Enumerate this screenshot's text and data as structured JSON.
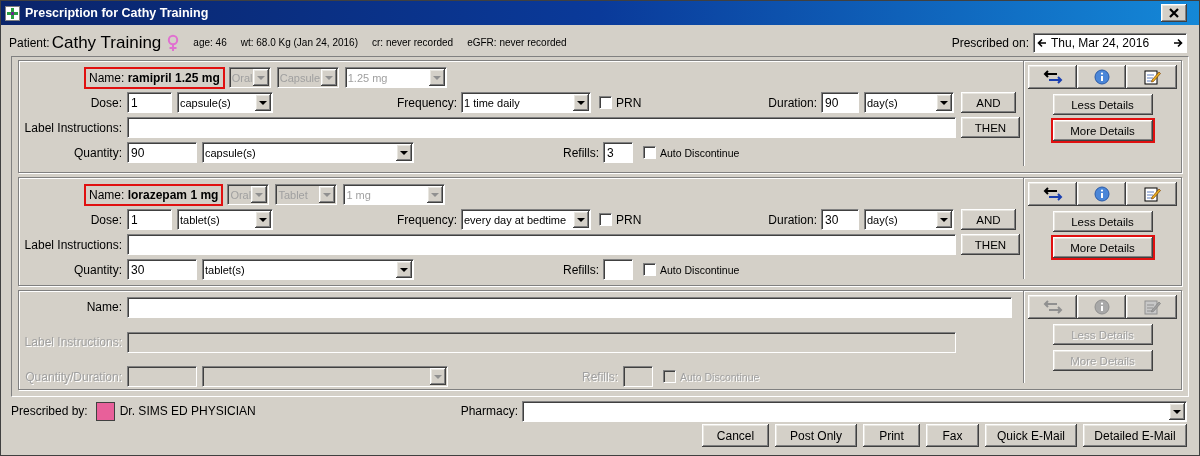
{
  "window": {
    "title": "Prescription for Cathy Training"
  },
  "patient": {
    "label": "Patient:",
    "name": "Cathy Training",
    "age": "age: 46",
    "weight": "wt: 68.0 Kg (Jan 24, 2016)",
    "cr": "cr: never recorded",
    "egfr": "eGFR: never recorded"
  },
  "prescribed_on": {
    "label": "Prescribed on:",
    "date": "Thu, Mar 24, 2016"
  },
  "prescriptions": [
    {
      "kind": "active",
      "name_label": "Name:",
      "name": "ramipril 1.25 mg",
      "highlighted": true,
      "route": "Oral",
      "form": "Capsule",
      "strength": "1.25 mg",
      "dose_label": "Dose:",
      "dose": "1",
      "dose_unit": "capsule(s)",
      "frequency_label": "Frequency:",
      "frequency": "1 time daily",
      "prn": {
        "label": "PRN",
        "checked": false
      },
      "duration_label": "Duration:",
      "duration": "90",
      "duration_unit": "day(s)",
      "and_button": "AND",
      "instructions_label": "Label Instructions:",
      "then_button": "THEN",
      "quantity_label": "Quantity:",
      "quantity": "90",
      "quantity_unit": "capsule(s)",
      "refills_label": "Refills:",
      "refills": "3",
      "auto_discontinue": {
        "label": "Auto Discontinue",
        "checked": false
      },
      "less_details": "Less Details",
      "more_details": {
        "label": "More Details",
        "highlighted": true
      }
    },
    {
      "kind": "active",
      "name_label": "Name:",
      "name": "lorazepam 1 mg",
      "highlighted": true,
      "route": "Oral",
      "form": "Tablet",
      "strength": "1 mg",
      "dose_label": "Dose:",
      "dose": "1",
      "dose_unit": "tablet(s)",
      "frequency_label": "Frequency:",
      "frequency": "every day at bedtime",
      "prn": {
        "label": "PRN",
        "checked": false
      },
      "duration_label": "Duration:",
      "duration": "30",
      "duration_unit": "day(s)",
      "and_button": "AND",
      "instructions_label": "Label Instructions:",
      "then_button": "THEN",
      "quantity_label": "Quantity:",
      "quantity": "30",
      "quantity_unit": "tablet(s)",
      "refills_label": "Refills:",
      "auto_discontinue": {
        "label": "Auto Discontinue",
        "checked": false
      },
      "less_details": "Less Details",
      "more_details": {
        "label": "More Details",
        "highlighted": true
      }
    },
    {
      "kind": "blank",
      "name_label": "Name:",
      "instructions_label": "Label Instructions:",
      "quantity_label": "Quantity/Duration:",
      "refills_label": "Refills:",
      "auto_discontinue": {
        "label": "Auto Discontinue",
        "checked": false
      },
      "less_details": "Less Details",
      "more_details": {
        "label": "More Details",
        "highlighted": false
      }
    }
  ],
  "prescriber": {
    "label": "Prescribed by:",
    "name": "Dr. SIMS ED PHYSICIAN"
  },
  "pharmacy": {
    "label": "Pharmacy:"
  },
  "buttons": [
    "Cancel",
    "Post Only",
    "Print",
    "Fax",
    "Quick E-Mail",
    "Detailed E-Mail"
  ]
}
